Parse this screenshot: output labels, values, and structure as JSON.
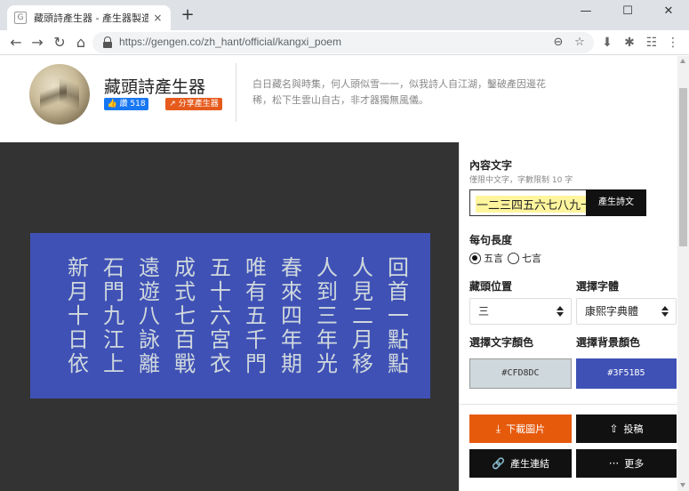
{
  "browser": {
    "tab_title": "藏頭詩產生器 - 產生器製造機⚡",
    "tab_favicon": "G",
    "url": "https://gengen.co/zh_hant/official/kangxi_poem",
    "new_tab_label": "+",
    "icons": {
      "close_tab": "×",
      "back": "←",
      "forward": "→",
      "reload": "↻",
      "home": "⌂",
      "zoom": "⊖",
      "bookmark": "☆",
      "download_ext": "⬇",
      "extensions": "✱",
      "profile": "☷",
      "menu": "⋮",
      "minimize": "—",
      "maximize": "☐",
      "close_window": "✕"
    }
  },
  "header": {
    "title": "藏頭詩產生器",
    "like_label": "👍 讚 518",
    "share_label": "↗ 分享產生器",
    "description": "白日藏名與時集，何人頭似雪一一，似我詩人自江湖，鑿破產因邊花稀，松下生雲山自古，非才器獨無風儀。"
  },
  "poem": {
    "text_color": "#CFD8DC",
    "background_color": "#3F51B5",
    "columns": [
      [
        "回",
        "首",
        "一",
        "點",
        "點"
      ],
      [
        "人",
        "見",
        "二",
        "月",
        "移"
      ],
      [
        "人",
        "到",
        "三",
        "年",
        "光"
      ],
      [
        "春",
        "來",
        "四",
        "年",
        "期"
      ],
      [
        "唯",
        "有",
        "五",
        "千",
        "門"
      ],
      [
        "五",
        "十",
        "六",
        "宮",
        "衣"
      ],
      [
        "成",
        "式",
        "七",
        "百",
        "戰"
      ],
      [
        "遠",
        "遊",
        "八",
        "詠",
        "離"
      ],
      [
        "石",
        "門",
        "九",
        "江",
        "上"
      ],
      [
        "新",
        "月",
        "十",
        "日",
        "依"
      ]
    ]
  },
  "panel": {
    "content_label": "內容文字",
    "content_hint": "僅限中文字，字數限制 10 字",
    "content_value": "一二三四五六七八九十",
    "generate_text_label": "產生詩文",
    "line_length_label": "每句長度",
    "option_five": "五言",
    "option_seven": "七言",
    "selected_line_length": "五言",
    "position_label": "藏頭位置",
    "position_value": "三",
    "font_label": "選擇字體",
    "font_value": "康熙字典體",
    "text_color_label": "選擇文字顏色",
    "text_color_value": "#CFD8DC",
    "bg_color_label": "選擇背景顏色",
    "bg_color_value": "#3F51B5",
    "download_label": "下載圖片",
    "submit_label": "投稿",
    "link_label": "產生連結",
    "more_label": "更多",
    "icons": {
      "download": "⤓",
      "submit": "⇧",
      "link": "🔗",
      "more": "···"
    }
  },
  "colors": {
    "download_btn": "#E65A0C",
    "dark_btn": "#111111",
    "canvas_bg": "#333333"
  }
}
